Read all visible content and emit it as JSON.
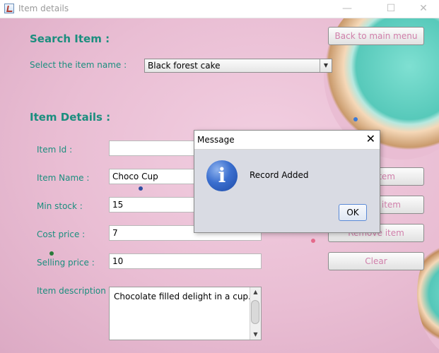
{
  "window": {
    "title": "Item details",
    "controls": {
      "minimize": "—",
      "maximize": "☐",
      "close": "✕"
    }
  },
  "search": {
    "heading": "Search Item :",
    "select_label": "Select the item name :",
    "selected_item": "Black forest cake"
  },
  "details": {
    "heading": "Item Details :",
    "fields": {
      "item_id": {
        "label": "Item Id :",
        "value": ""
      },
      "item_name": {
        "label": "Item Name :",
        "value": "Choco Cup"
      },
      "min_stock": {
        "label": "Min stock :",
        "value": "15"
      },
      "cost_price": {
        "label": "Cost price :",
        "value": "7"
      },
      "selling_price": {
        "label": "Selling price :",
        "value": "10"
      },
      "description": {
        "label": "Item description :",
        "value": "Chocolate filled delight in a cup."
      }
    }
  },
  "buttons": {
    "back": "Back to main menu",
    "add_partial": "tem",
    "update_partial": "item",
    "remove": "Remove item",
    "clear": "Clear"
  },
  "dialog": {
    "title": "Message",
    "close": "✕",
    "icon_glyph": "i",
    "message": "Record Added",
    "ok": "OK"
  },
  "colors": {
    "accent": "#1b8e7e",
    "button_text": "#d07faa"
  }
}
